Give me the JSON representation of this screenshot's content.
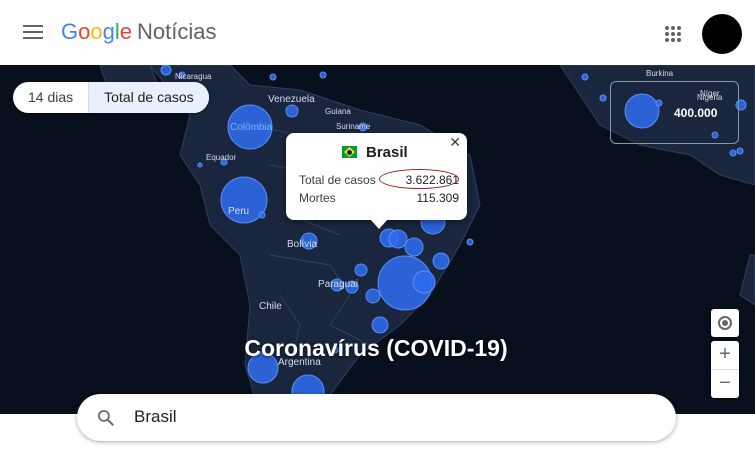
{
  "header": {
    "logo": {
      "g1": "G",
      "o1": "o",
      "o2": "o",
      "g2": "g",
      "l": "l",
      "e": "e",
      "product": "Notícias"
    },
    "menu_icon": "menu-icon",
    "apps_icon": "apps-grid-icon"
  },
  "chips": [
    {
      "label": "14 dias",
      "active": false
    },
    {
      "label": "Total de casos",
      "active": true
    }
  ],
  "map": {
    "labels": {
      "nicaragua": "Nicaragua",
      "venezuela": "Venezuela",
      "guiana": "Guiana",
      "suriname": "Suriname",
      "colombia": "Colômbia",
      "equador": "Equador",
      "peru": "Peru",
      "bolivia": "Bolívia",
      "paraguai": "Paraguai",
      "chile": "Chile",
      "argentina": "Argentina",
      "burkina": "Burkina",
      "niger": "Níger",
      "nigeria": "Nigéria"
    },
    "legend_value": "400.000",
    "title": "Coronavírus (COVID-19)"
  },
  "popup": {
    "country": "Brasil",
    "close_icon": "close-icon",
    "rows": [
      {
        "label": "Total de casos",
        "value": "3.622.861"
      },
      {
        "label": "Mortes",
        "value": "115.309"
      }
    ]
  },
  "controls": {
    "locate": "my-location-icon",
    "zoom_in": "+",
    "zoom_out": "−"
  },
  "search": {
    "value": "Brasil",
    "icon": "search-icon"
  },
  "colors": {
    "map_bg": "#07101c",
    "bubble": "#2f6df0",
    "accent": "#4285F4"
  }
}
